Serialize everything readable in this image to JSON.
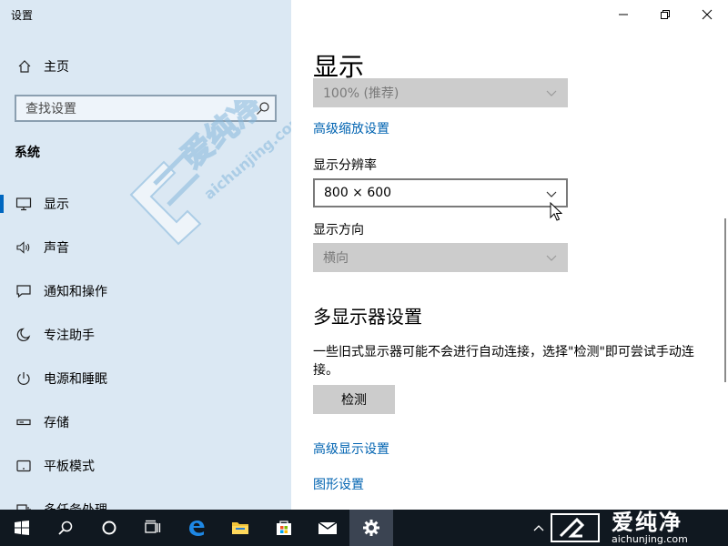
{
  "app": {
    "title": "设置"
  },
  "sidebar": {
    "home_label": "主页",
    "search_placeholder": "查找设置",
    "section_title": "系统",
    "items": [
      {
        "label": "显示",
        "icon": "monitor-icon",
        "active": true
      },
      {
        "label": "声音",
        "icon": "speaker-icon"
      },
      {
        "label": "通知和操作",
        "icon": "notification-icon"
      },
      {
        "label": "专注助手",
        "icon": "moon-icon"
      },
      {
        "label": "电源和睡眠",
        "icon": "power-icon"
      },
      {
        "label": "存储",
        "icon": "storage-icon"
      },
      {
        "label": "平板模式",
        "icon": "tablet-icon"
      },
      {
        "label": "多任务处理",
        "icon": "multitask-icon"
      }
    ]
  },
  "watermark": {
    "cn": "爱纯净",
    "en": "aichunjing.com"
  },
  "content": {
    "title": "显示",
    "scale_value": "100% (推荐)",
    "advanced_scale_link": "高级缩放设置",
    "resolution_label": "显示分辨率",
    "resolution_value": "800 × 600",
    "orientation_label": "显示方向",
    "orientation_value": "横向",
    "multi_title": "多显示器设置",
    "multi_desc": "一些旧式显示器可能不会进行自动连接，选择\"检测\"即可尝试手动连接。",
    "detect_button": "检测",
    "advanced_display_link": "高级显示设置",
    "graphics_link": "图形设置"
  },
  "taskbar": {
    "items": [
      "windows-start-icon",
      "search-icon",
      "cortana-icon",
      "task-view-icon",
      "edge-icon",
      "file-explorer-icon",
      "store-icon",
      "mail-icon",
      "settings-icon"
    ],
    "active_item": "settings-icon"
  },
  "brand": {
    "cn": "爱纯净",
    "en": "aichunjing.com"
  },
  "colors": {
    "sidebar_bg": "#dbe8f3",
    "link": "#0063b1",
    "accent": "#0067c0",
    "taskbar": "#101820",
    "disabled": "#cccccc"
  }
}
